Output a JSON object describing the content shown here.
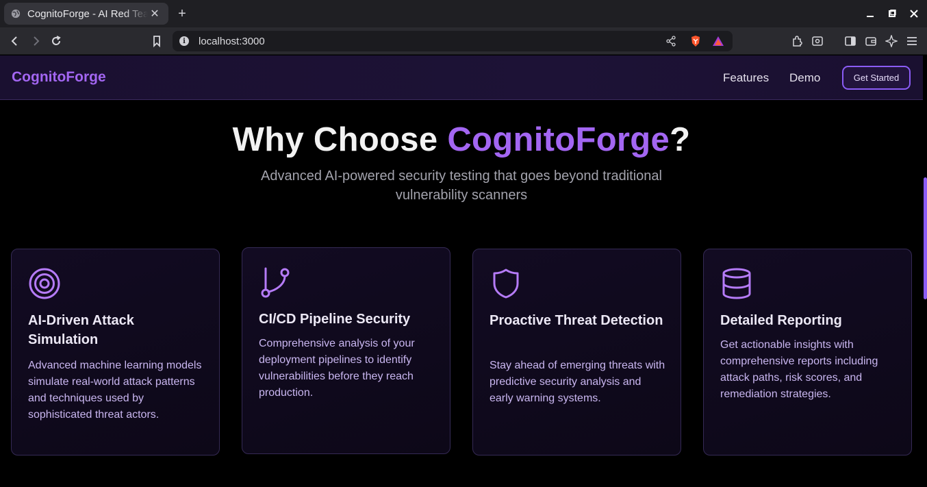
{
  "browser": {
    "tab_title": "CognitoForge - AI Red Team",
    "tab_close": "✕",
    "new_tab": "+",
    "url": "localhost:3000"
  },
  "nav": {
    "brand": "CognitoForge",
    "links": [
      "Features",
      "Demo"
    ],
    "cta": "Get Started"
  },
  "hero": {
    "heading_prefix": "Why Choose ",
    "heading_accent": "CognitoForge",
    "heading_suffix": "?",
    "subheading": "Advanced AI-powered security testing that goes beyond traditional vulnerability scanners"
  },
  "features": [
    {
      "icon": "target-icon",
      "title": "AI-Driven Attack Simulation",
      "text": "Advanced machine learning models simulate real-world attack patterns and techniques used by sophisticated threat actors."
    },
    {
      "icon": "git-branch-icon",
      "title": "CI/CD Pipeline Security",
      "text": "Comprehensive analysis of your deployment pipelines to identify vulnerabilities before they reach production."
    },
    {
      "icon": "shield-icon",
      "title": "Proactive Threat Detection",
      "text": "Stay ahead of emerging threats with predictive security analysis and early warning systems."
    },
    {
      "icon": "database-icon",
      "title": "Detailed Reporting",
      "text": "Get actionable insights with comprehensive reports including attack paths, risk scores, and remediation strategies."
    }
  ],
  "colors": {
    "accent": "#a366f2",
    "card_border": "#352a55",
    "card_text": "#c9b6f0"
  }
}
